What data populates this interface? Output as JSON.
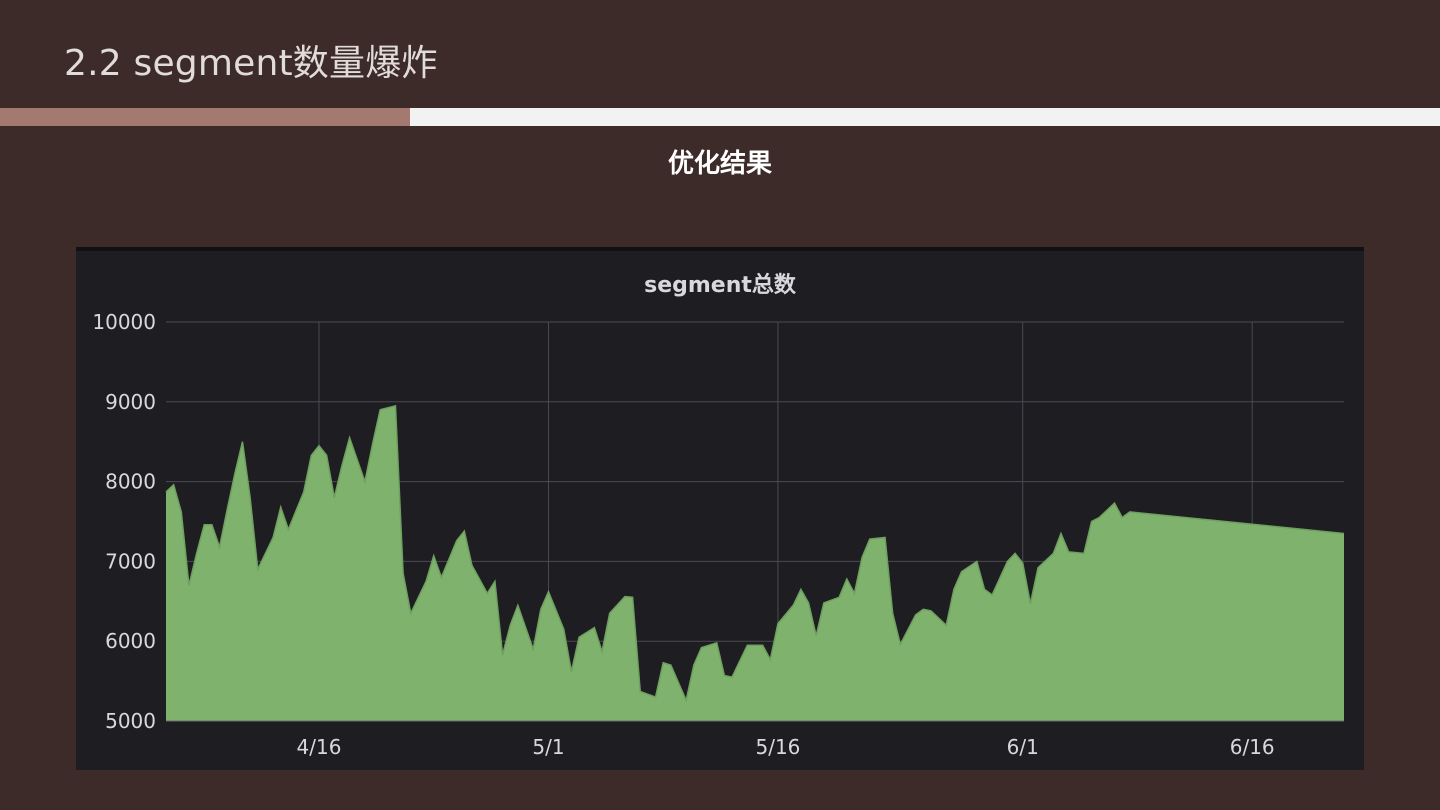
{
  "slide": {
    "title": "2.2 segment数量爆炸",
    "subtitle": "优化结果",
    "accent_color": "#a47970",
    "background_color": "#3d2b29"
  },
  "chart_data": {
    "type": "area",
    "title": "segment总数",
    "xlabel": "",
    "ylabel": "",
    "ylim": [
      5000,
      10000
    ],
    "yticks": [
      10000,
      9000,
      8000,
      7000,
      6000,
      5000
    ],
    "xrange": [
      "04-06",
      "06-22"
    ],
    "xticks": [
      {
        "date": "04-16",
        "label": "4/16"
      },
      {
        "date": "05-01",
        "label": "5/1"
      },
      {
        "date": "05-16",
        "label": "5/16"
      },
      {
        "date": "06-01",
        "label": "6/1"
      },
      {
        "date": "06-16",
        "label": "6/16"
      }
    ],
    "grid": true,
    "legend": "none",
    "fill_color": "#7eb26d",
    "line_color": "#6fa05f",
    "series": [
      {
        "points": [
          [
            "04-06",
            7870
          ],
          [
            "04-06",
            7960
          ],
          [
            "04-07",
            7620
          ],
          [
            "04-07",
            6700
          ],
          [
            "04-08",
            7100
          ],
          [
            "04-08",
            7460
          ],
          [
            "04-09",
            7460
          ],
          [
            "04-09",
            7180
          ],
          [
            "04-10",
            7650
          ],
          [
            "04-10",
            8100
          ],
          [
            "04-11",
            8500
          ],
          [
            "04-11",
            7800
          ],
          [
            "04-12",
            6900
          ],
          [
            "04-13",
            7300
          ],
          [
            "04-13",
            7680
          ],
          [
            "04-14",
            7400
          ],
          [
            "04-15",
            7870
          ],
          [
            "04-15",
            8330
          ],
          [
            "04-16",
            8450
          ],
          [
            "04-16",
            8330
          ],
          [
            "04-17",
            7800
          ],
          [
            "04-17",
            8200
          ],
          [
            "04-18",
            8550
          ],
          [
            "04-19",
            8000
          ],
          [
            "04-19",
            8470
          ],
          [
            "04-20",
            8900
          ],
          [
            "04-21",
            8950
          ],
          [
            "04-21",
            6850
          ],
          [
            "04-22",
            6350
          ],
          [
            "04-23",
            6750
          ],
          [
            "04-23",
            7070
          ],
          [
            "04-24",
            6800
          ],
          [
            "04-25",
            7260
          ],
          [
            "04-25",
            7380
          ],
          [
            "04-26",
            6950
          ],
          [
            "04-27",
            6600
          ],
          [
            "04-27",
            6750
          ],
          [
            "04-28",
            5830
          ],
          [
            "04-28",
            6200
          ],
          [
            "04-29",
            6450
          ],
          [
            "04-30",
            5900
          ],
          [
            "04-30",
            6400
          ],
          [
            "05-01",
            6620
          ],
          [
            "05-02",
            6150
          ],
          [
            "05-02",
            5620
          ],
          [
            "05-03",
            6050
          ],
          [
            "05-04",
            6170
          ],
          [
            "05-04",
            5870
          ],
          [
            "05-05",
            6350
          ],
          [
            "05-06",
            6560
          ],
          [
            "05-06",
            6550
          ],
          [
            "05-07",
            5370
          ],
          [
            "05-08",
            5300
          ],
          [
            "05-08",
            5730
          ],
          [
            "05-09",
            5700
          ],
          [
            "05-10",
            5260
          ],
          [
            "05-10",
            5700
          ],
          [
            "05-11",
            5920
          ],
          [
            "05-12",
            5980
          ],
          [
            "05-12",
            5570
          ],
          [
            "05-13",
            5550
          ],
          [
            "05-14",
            5950
          ],
          [
            "05-15",
            5950
          ],
          [
            "05-15",
            5770
          ],
          [
            "05-16",
            6220
          ],
          [
            "05-17",
            6450
          ],
          [
            "05-17",
            6650
          ],
          [
            "05-18",
            6480
          ],
          [
            "05-18",
            6070
          ],
          [
            "05-19",
            6480
          ],
          [
            "05-20",
            6550
          ],
          [
            "05-20",
            6780
          ],
          [
            "05-21",
            6600
          ],
          [
            "05-21",
            7050
          ],
          [
            "05-22",
            7280
          ],
          [
            "05-23",
            7300
          ],
          [
            "05-23",
            6350
          ],
          [
            "05-24",
            5960
          ],
          [
            "05-25",
            6330
          ],
          [
            "05-25",
            6400
          ],
          [
            "05-26",
            6380
          ],
          [
            "05-27",
            6200
          ],
          [
            "05-27",
            6650
          ],
          [
            "05-28",
            6870
          ],
          [
            "05-29",
            7000
          ],
          [
            "05-29",
            6650
          ],
          [
            "05-30",
            6580
          ],
          [
            "05-31",
            7000
          ],
          [
            "05-31",
            7100
          ],
          [
            "06-01",
            6980
          ],
          [
            "06-01",
            6470
          ],
          [
            "06-02",
            6920
          ],
          [
            "06-03",
            7100
          ],
          [
            "06-03",
            7350
          ],
          [
            "06-04",
            7120
          ],
          [
            "06-05",
            7100
          ],
          [
            "06-05",
            7500
          ],
          [
            "06-06",
            7550
          ],
          [
            "06-07",
            7730
          ],
          [
            "06-07",
            7550
          ],
          [
            "06-08",
            7620
          ],
          [
            "06-08",
            7350
          ]
        ]
      }
    ]
  }
}
